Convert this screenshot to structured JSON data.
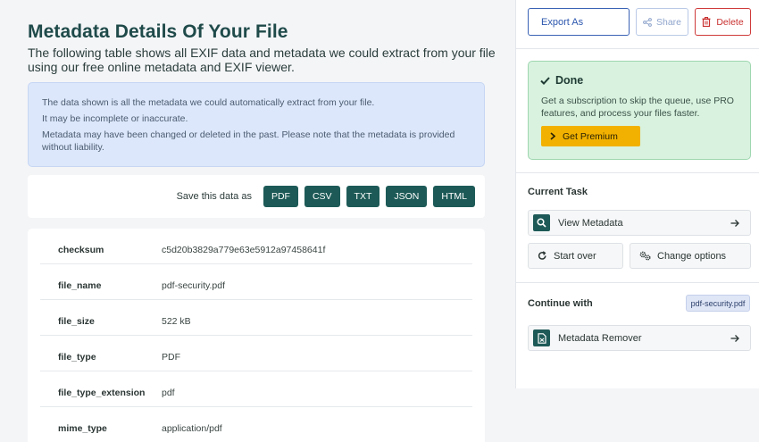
{
  "main": {
    "title": "Metadata Details Of Your File",
    "subtitle": "The following table shows all EXIF data and metadata we could extract from your file using our free online metadata and EXIF viewer.",
    "notice": [
      "The data shown is all the metadata we could automatically extract from your file.",
      "It may be incomplete or inaccurate.",
      "Metadata may have been changed or deleted in the past. Please note that the metadata is provided without liability."
    ],
    "save_label": "Save this data as",
    "formats": [
      "PDF",
      "CSV",
      "TXT",
      "JSON",
      "HTML"
    ],
    "metadata": [
      {
        "key": "checksum",
        "value": "c5d20b3829a779e63e5912a97458641f"
      },
      {
        "key": "file_name",
        "value": "pdf-security.pdf"
      },
      {
        "key": "file_size",
        "value": "522 kB"
      },
      {
        "key": "file_type",
        "value": "PDF"
      },
      {
        "key": "file_type_extension",
        "value": "pdf"
      },
      {
        "key": "mime_type",
        "value": "application/pdf"
      }
    ]
  },
  "sidebar": {
    "export_label": "Export As",
    "share_label": "Share",
    "delete_label": "Delete",
    "done": {
      "title": "Done",
      "text": "Get a subscription to skip the queue, use PRO features, and process your files faster.",
      "premium_label": "Get Premium"
    },
    "current_task_heading": "Current Task",
    "view_metadata_label": "View Metadata",
    "start_over_label": "Start over",
    "change_options_label": "Change options",
    "continue_heading": "Continue with",
    "file_chip": "pdf-security.pdf",
    "metadata_remover_label": "Metadata Remover"
  },
  "colors": {
    "accent": "#1d5a57",
    "export_blue": "#2c57ae",
    "delete_red": "#c8302f",
    "premium_yellow": "#f2b100",
    "done_green": "#d8f2df"
  }
}
